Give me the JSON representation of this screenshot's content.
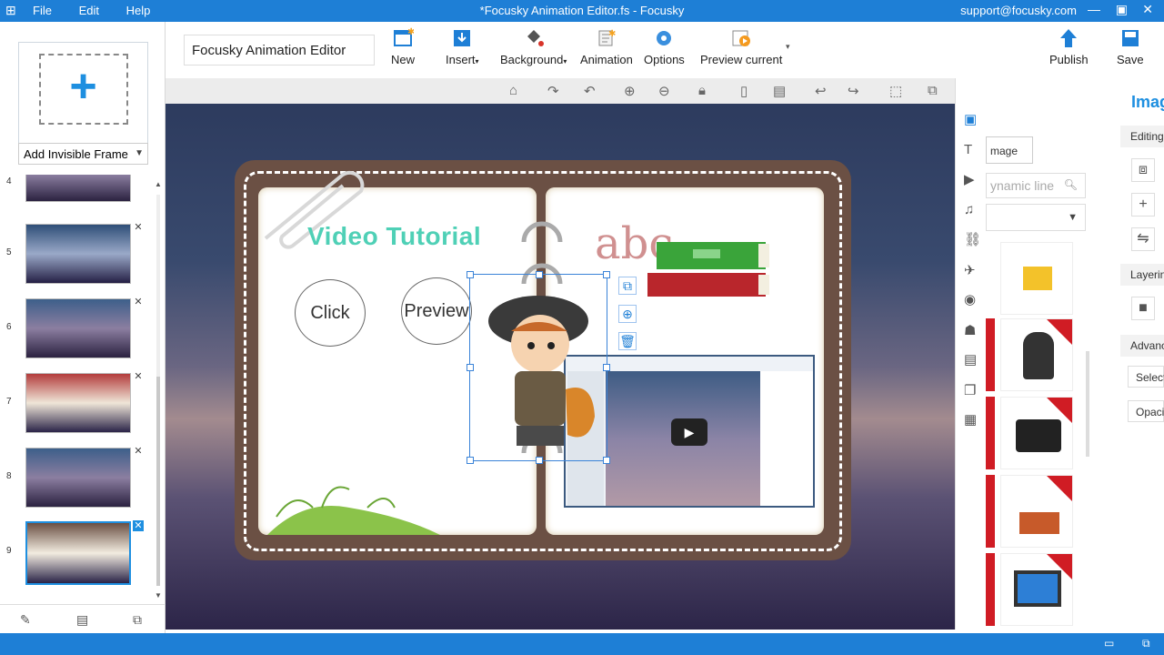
{
  "titlebar": {
    "menu": [
      "File",
      "Edit",
      "Help"
    ],
    "title": "*Focusky Animation Editor.fs - Focusky",
    "email": "support@focusky.com"
  },
  "sidebar": {
    "add_frame_select": "Add Invisible Frame",
    "thumbnails": [
      {
        "num": "4"
      },
      {
        "num": "5"
      },
      {
        "num": "6"
      },
      {
        "num": "7"
      },
      {
        "num": "8"
      },
      {
        "num": "9"
      }
    ]
  },
  "ribbon": {
    "title_value": "Focusky Animation Editor",
    "new": "New",
    "insert": "Insert",
    "background": "Background",
    "animation": "Animation",
    "options": "Options",
    "preview": "Preview current",
    "publish": "Publish",
    "save": "Save"
  },
  "canvas": {
    "video_title": "Video Tutorial",
    "click_label": "Click",
    "preview_label": "Preview",
    "abc": "abc"
  },
  "right_panel": {
    "tab_image": "mage",
    "search_placeholder": "ynamic line"
  },
  "props": {
    "heading": "Imag",
    "editing": "Editing",
    "layering": "Layerin",
    "advanced": "Advanc",
    "select": "Select",
    "opacity": "Opaci"
  },
  "colors": {
    "accent": "#1e7fd6",
    "title_green": "#4fd0b6",
    "pro_badge": "#d01c24"
  },
  "icons": [
    "add-frame-icon",
    "home-icon",
    "zoom-in-icon",
    "zoom-out-icon",
    "lock-icon",
    "undo-icon",
    "redo-icon",
    "image-icon",
    "text-icon",
    "video-icon",
    "music-icon",
    "link-icon",
    "plane-icon",
    "flash-icon",
    "people-icon",
    "slides-icon",
    "layers-icon",
    "layout-icon",
    "play-icon"
  ]
}
